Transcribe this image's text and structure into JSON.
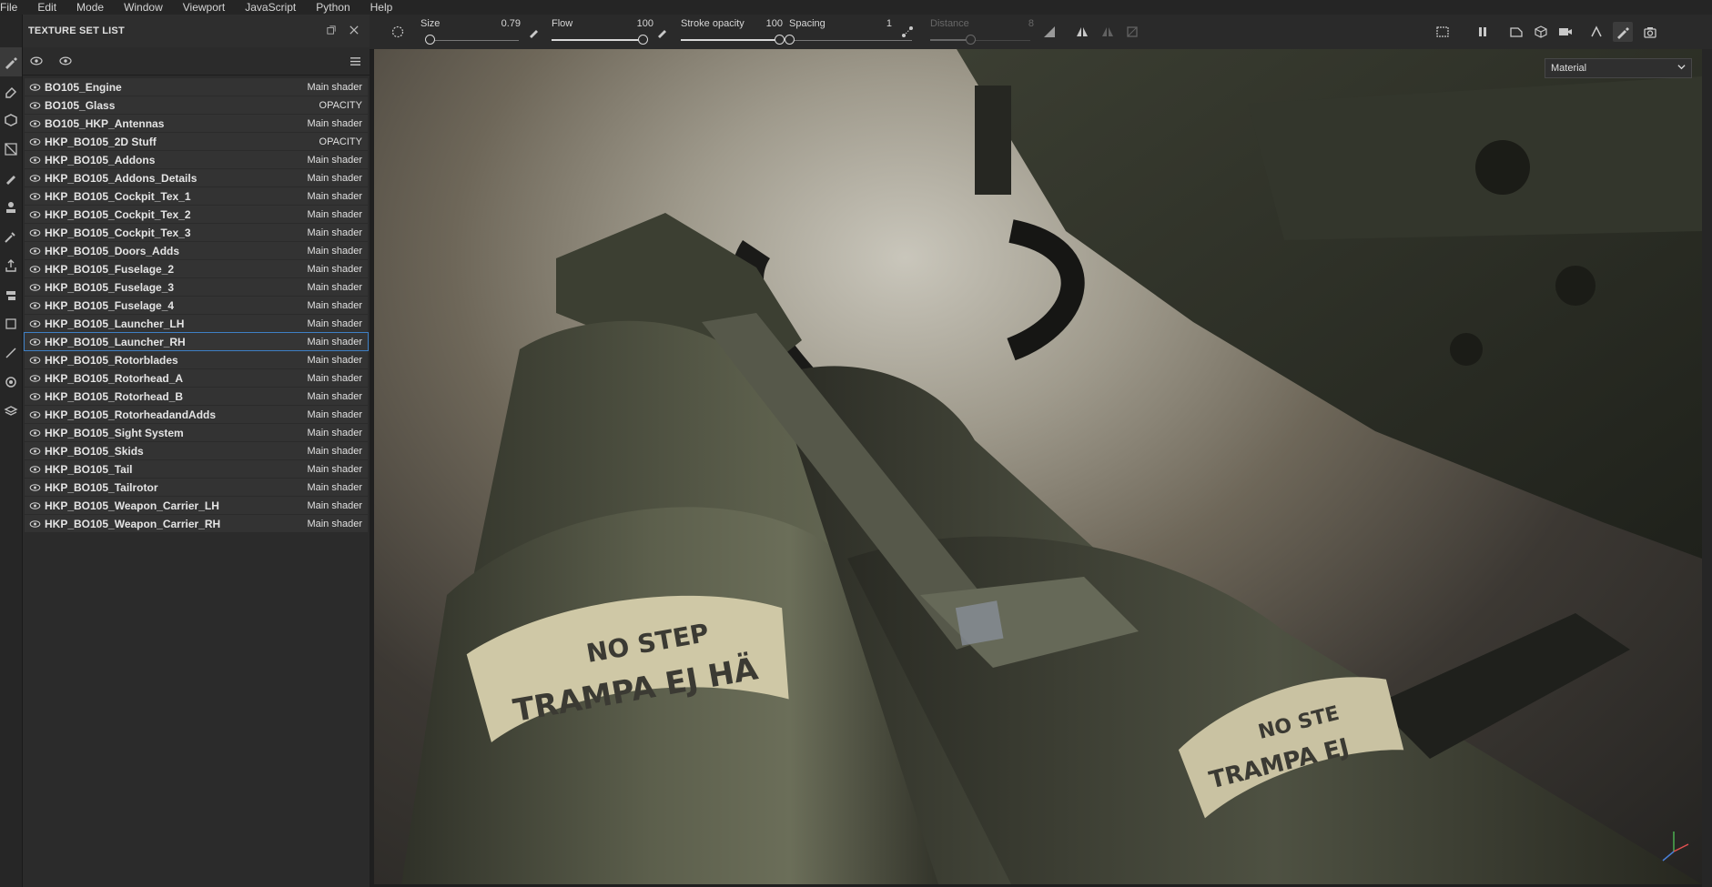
{
  "menu": [
    "File",
    "Edit",
    "Mode",
    "Window",
    "Viewport",
    "JavaScript",
    "Python",
    "Help"
  ],
  "texture_set_list": {
    "title": "TEXTURE SET LIST",
    "items": [
      {
        "name": "BO105_Engine",
        "shader": "Main shader"
      },
      {
        "name": "BO105_Glass",
        "shader": "OPACITY"
      },
      {
        "name": "BO105_HKP_Antennas",
        "shader": "Main shader"
      },
      {
        "name": "HKP_BO105_2D Stuff",
        "shader": "OPACITY"
      },
      {
        "name": "HKP_BO105_Addons",
        "shader": "Main shader"
      },
      {
        "name": "HKP_BO105_Addons_Details",
        "shader": "Main shader"
      },
      {
        "name": "HKP_BO105_Cockpit_Tex_1",
        "shader": "Main shader"
      },
      {
        "name": "HKP_BO105_Cockpit_Tex_2",
        "shader": "Main shader"
      },
      {
        "name": "HKP_BO105_Cockpit_Tex_3",
        "shader": "Main shader"
      },
      {
        "name": "HKP_BO105_Doors_Adds",
        "shader": "Main shader"
      },
      {
        "name": "HKP_BO105_Fuselage_2",
        "shader": "Main shader"
      },
      {
        "name": "HKP_BO105_Fuselage_3",
        "shader": "Main shader"
      },
      {
        "name": "HKP_BO105_Fuselage_4",
        "shader": "Main shader"
      },
      {
        "name": "HKP_BO105_Launcher_LH",
        "shader": "Main shader"
      },
      {
        "name": "HKP_BO105_Launcher_RH",
        "shader": "Main shader",
        "selected": true
      },
      {
        "name": "HKP_BO105_Rotorblades",
        "shader": "Main shader"
      },
      {
        "name": "HKP_BO105_Rotorhead_A",
        "shader": "Main shader"
      },
      {
        "name": "HKP_BO105_Rotorhead_B",
        "shader": "Main shader"
      },
      {
        "name": "HKP_BO105_RotorheadandAdds",
        "shader": "Main shader"
      },
      {
        "name": "HKP_BO105_Sight System",
        "shader": "Main shader"
      },
      {
        "name": "HKP_BO105_Skids",
        "shader": "Main shader"
      },
      {
        "name": "HKP_BO105_Tail",
        "shader": "Main shader"
      },
      {
        "name": "HKP_BO105_Tailrotor",
        "shader": "Main shader"
      },
      {
        "name": "HKP_BO105_Weapon_Carrier_LH",
        "shader": "Main shader"
      },
      {
        "name": "HKP_BO105_Weapon_Carrier_RH",
        "shader": "Main shader"
      }
    ]
  },
  "toolbar": {
    "size": {
      "label": "Size",
      "value": "0.79",
      "fraction": 0.02
    },
    "flow": {
      "label": "Flow",
      "value": "100",
      "fraction": 1.0
    },
    "stroke_opacity": {
      "label": "Stroke opacity",
      "value": "100",
      "fraction": 1.0
    },
    "spacing": {
      "label": "Spacing",
      "value": "1",
      "fraction": 0.0
    },
    "distance": {
      "label": "Distance",
      "value": "8",
      "fraction": 0.4
    }
  },
  "viewport": {
    "material_select": "Material",
    "decal_left_line1": "NO STEP",
    "decal_left_line2": "TRAMPA EJ HÄ",
    "decal_right_line1": "NO STE",
    "decal_right_line2": "TRAMPA EJ"
  },
  "colors": {
    "accent": "#3e7fc4",
    "panel": "#2b2b2b",
    "olive": "#4a4c3c"
  }
}
